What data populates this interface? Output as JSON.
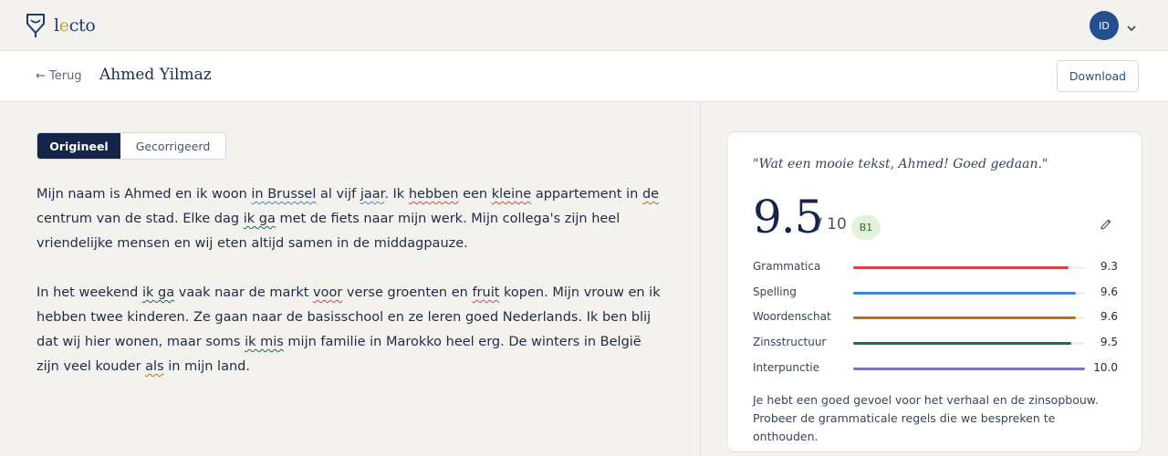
{
  "brand": {
    "logo_prefix": "l",
    "logo_accent": "e",
    "logo_suffix": "cto"
  },
  "user": {
    "initials": "ID"
  },
  "subbar": {
    "back_label": "← Terug",
    "student_name": "Ahmed Yilmaz",
    "download_label": "Download"
  },
  "view_toggle": {
    "original_label": "Origineel",
    "corrected_label": "Gecorrigeerd",
    "selected": "Origineel"
  },
  "essay": {
    "p1": {
      "s1": "Mijn naam is Ahmed en ik woon ",
      "e1": "in Brussel",
      "s2": " al vijf ",
      "e2": "jaar",
      "s3": ". Ik ",
      "e3": "hebben",
      "s4": " een ",
      "e4": "kleine",
      "s5": " appartement in ",
      "e5": "de",
      "s6": " centrum van de stad. Elke dag ",
      "e6": "ik ga",
      "s7": " met de fiets naar mijn werk. Mijn collega's zijn heel vriendelijke mensen en wij eten altijd samen in de middagpauze."
    },
    "p2": {
      "s1": "In het weekend ",
      "e1": "ik ga",
      "s2": " vaak naar de markt ",
      "e2": "voor",
      "s3": " verse groenten en ",
      "e3": "fruit",
      "s4": " kopen. Mijn vrouw en ik hebben twee kinderen. Ze gaan naar de basisschool en ze leren goed Nederlands. Ik ben blij dat wij hier wonen, maar soms ",
      "e4": "ik mis",
      "s5": " mijn familie in Marokko heel erg. De winters in België zijn veel kouder ",
      "e5": "als",
      "s6": " in mijn land."
    }
  },
  "score_card": {
    "quote": "\"Wat een mooie tekst, Ahmed! Goed gedaan.\"",
    "score": "9.5",
    "out_of": "/ 10",
    "level": "B1",
    "metrics": [
      {
        "label": "Grammatica",
        "value": "9.3",
        "fill": 0.93,
        "color": "#d64545"
      },
      {
        "label": "Spelling",
        "value": "9.6",
        "fill": 0.96,
        "color": "#3a86d6"
      },
      {
        "label": "Woordenschat",
        "value": "9.6",
        "fill": 0.96,
        "color": "#b86f10"
      },
      {
        "label": "Zinsstructuur",
        "value": "9.5",
        "fill": 0.94,
        "color": "#14704a"
      },
      {
        "label": "Interpunctie",
        "value": "10.0",
        "fill": 1.0,
        "color": "#7b6cd9"
      }
    ],
    "feedback": "Je hebt een goed gevoel voor het verhaal en de zinsopbouw. Probeer de grammaticale regels die we bespreken te onthouden."
  },
  "icons": {
    "logo": "lecto-logo-icon",
    "chevron": "chevron-down-icon",
    "edit": "pencil-icon"
  }
}
